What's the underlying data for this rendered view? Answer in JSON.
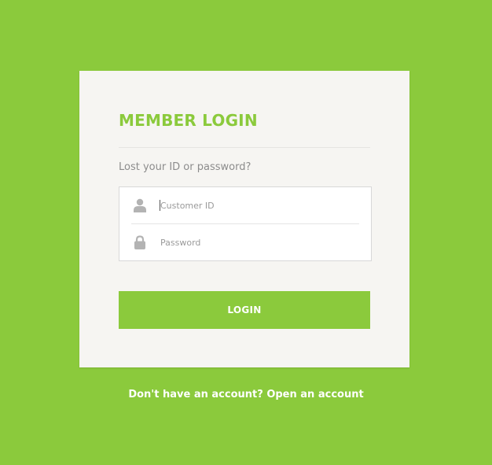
{
  "login_card": {
    "title": "MEMBER LOGIN",
    "lost_link": "Lost your ID or password?",
    "customer_id_placeholder": "Customer ID",
    "password_placeholder": "Password",
    "login_button": "LOGIN"
  },
  "footer": {
    "prompt": "Don't have an account?",
    "signup_link": "Open an account"
  },
  "icons": {
    "customer_id": "user-icon",
    "password": "lock-icon"
  },
  "colors": {
    "brand_green": "#8bca3c",
    "card_background": "#f6f5f2",
    "muted_text": "#8c8c8c"
  }
}
